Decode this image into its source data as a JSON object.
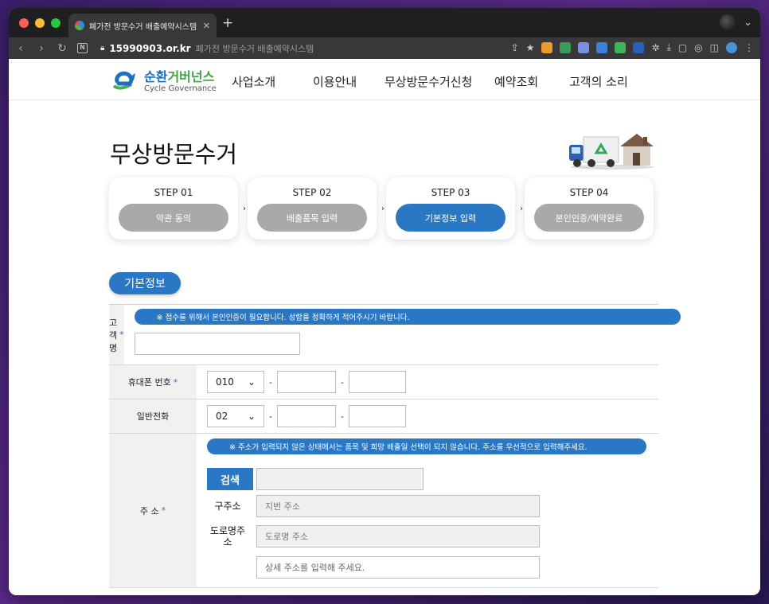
{
  "browser": {
    "tab_title": "폐가전 방문수거 배출예약시스템",
    "url_domain": "15990903.or.kr",
    "url_title": "폐가전 방문수거 배출예약시스템"
  },
  "logo": {
    "ko_a": "순환",
    "ko_b": "거버넌스",
    "en": "Cycle Governance"
  },
  "nav": [
    "사업소개",
    "이용안내",
    "무상방문수거신청",
    "예약조회",
    "고객의 소리"
  ],
  "page_title": "무상방문수거",
  "steps": [
    {
      "label": "STEP 01",
      "pill": "약관 동의",
      "active": false
    },
    {
      "label": "STEP 02",
      "pill": "배출품목 입력",
      "active": false
    },
    {
      "label": "STEP 03",
      "pill": "기본정보 입력",
      "active": true
    },
    {
      "label": "STEP 04",
      "pill": "본인인증/예약완료",
      "active": false
    }
  ],
  "section_title": "기본정보",
  "form": {
    "name_label": "고객명",
    "name_notice": "※ 접수를 위해서 본인인증이 필요합니다. 성함을 정확하게 적어주시기 바랍니다.",
    "name_value": "",
    "mobile_label": "휴대폰 번호",
    "mobile_prefix": "010",
    "phone_label": "일반전화",
    "phone_prefix": "02",
    "address_label": "주 소",
    "address_notice": "※ 주소가 입력되지 않은 상태에서는 품목 및 희망 배출일 선택이 되지 않습니다. 주소를 우선적으로 입력해주세요.",
    "search_button": "검색",
    "old_addr_label": "구주소",
    "old_addr_placeholder": "지번 주소",
    "road_addr_label": "도로명주소",
    "road_addr_placeholder": "도로명 주소",
    "detail_placeholder": "상세 주소를 입력해 주세요."
  },
  "required_mark": "*",
  "colors": {
    "primary": "#2a78c4",
    "inactive_step": "#a9a9a9",
    "label_bg": "#f1f1f1"
  }
}
